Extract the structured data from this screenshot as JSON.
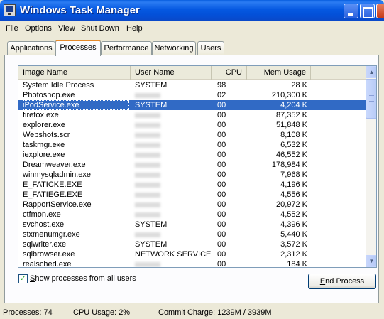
{
  "window": {
    "title": "Windows Task Manager"
  },
  "menu": [
    "File",
    "Options",
    "View",
    "Shut Down",
    "Help"
  ],
  "tabs": [
    "Applications",
    "Processes",
    "Performance",
    "Networking",
    "Users"
  ],
  "columns": {
    "name": "Image Name",
    "user": "User Name",
    "cpu": "CPU",
    "mem": "Mem Usage"
  },
  "processes": [
    {
      "name": "System Idle Process",
      "user": "SYSTEM",
      "cpu": "98",
      "mem": "28 K"
    },
    {
      "name": "Photoshop.exe",
      "user": "",
      "cpu": "02",
      "mem": "210,300 K"
    },
    {
      "name": "iPodService.exe",
      "user": "SYSTEM",
      "cpu": "00",
      "mem": "4,204 K"
    },
    {
      "name": "firefox.exe",
      "user": "",
      "cpu": "00",
      "mem": "87,352 K"
    },
    {
      "name": "explorer.exe",
      "user": "",
      "cpu": "00",
      "mem": "51,848 K"
    },
    {
      "name": "Webshots.scr",
      "user": "",
      "cpu": "00",
      "mem": "8,108 K"
    },
    {
      "name": "taskmgr.exe",
      "user": "",
      "cpu": "00",
      "mem": "6,532 K"
    },
    {
      "name": "iexplore.exe",
      "user": "",
      "cpu": "00",
      "mem": "46,552 K"
    },
    {
      "name": "Dreamweaver.exe",
      "user": "",
      "cpu": "00",
      "mem": "178,984 K"
    },
    {
      "name": "winmysqladmin.exe",
      "user": "",
      "cpu": "00",
      "mem": "7,968 K"
    },
    {
      "name": "E_FATICKE.EXE",
      "user": "",
      "cpu": "00",
      "mem": "4,196 K"
    },
    {
      "name": "E_FATIEGE.EXE",
      "user": "",
      "cpu": "00",
      "mem": "4,556 K"
    },
    {
      "name": "RapportService.exe",
      "user": "",
      "cpu": "00",
      "mem": "20,972 K"
    },
    {
      "name": "ctfmon.exe",
      "user": "",
      "cpu": "00",
      "mem": "4,552 K"
    },
    {
      "name": "svchost.exe",
      "user": "SYSTEM",
      "cpu": "00",
      "mem": "4,396 K"
    },
    {
      "name": "stxmenumgr.exe",
      "user": "",
      "cpu": "00",
      "mem": "5,440 K"
    },
    {
      "name": "sqlwriter.exe",
      "user": "SYSTEM",
      "cpu": "00",
      "mem": "3,572 K"
    },
    {
      "name": "sqlbrowser.exe",
      "user": "NETWORK SERVICE",
      "cpu": "00",
      "mem": "2,312 K"
    },
    {
      "name": "realsched.exe",
      "user": "",
      "cpu": "00",
      "mem": "184 K"
    }
  ],
  "selected_index": 2,
  "show_all": {
    "label": "Show processes from all users",
    "checked": true
  },
  "end_process_label": "End Process",
  "status": {
    "processes": "Processes: 74",
    "cpu": "CPU Usage: 2%",
    "commit": "Commit Charge: 1239M / 3939M"
  }
}
